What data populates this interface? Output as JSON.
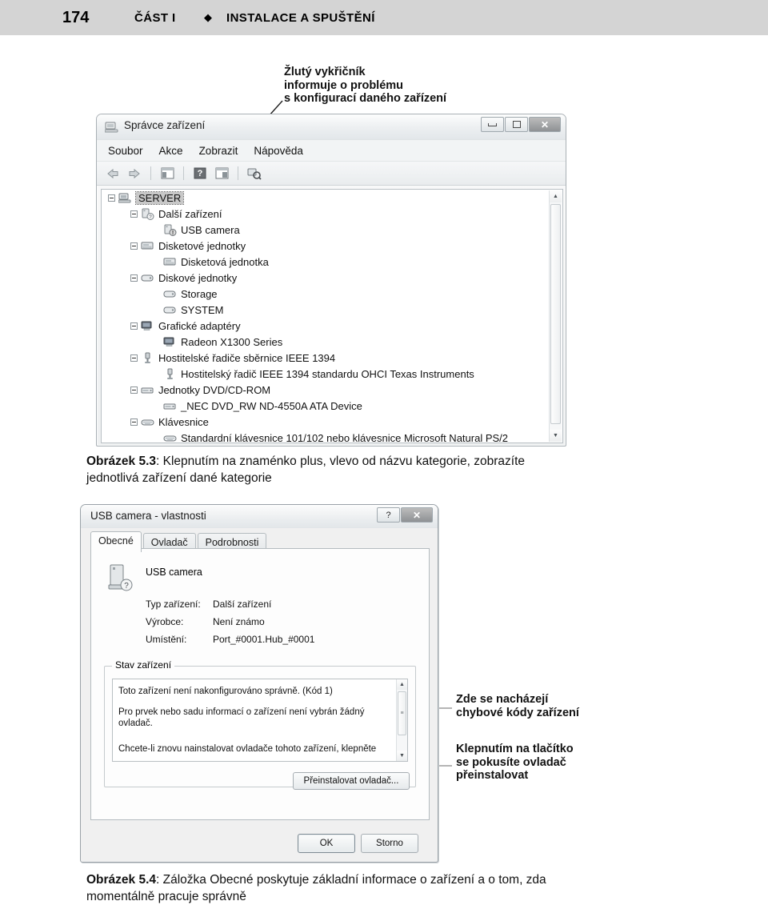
{
  "runhead": {
    "page_number": "174",
    "part_label": "ČÁST I",
    "separator": "◆",
    "chapter_label": "INSTALACE A SPUŠTĚNÍ"
  },
  "callouts": {
    "top": "Žlutý vykřičník\ninformuje o problému\ns konfigurací daného zařízení",
    "error_codes": "Zde se nacházejí\nchybové kódy zařízení",
    "reinstall": "Klepnutím na tlačítko\nse pokusíte ovladač\npřeinstalovat"
  },
  "device_manager": {
    "title": "Správce zařízení",
    "title_icon": "device-manager-icon",
    "window_buttons": [
      {
        "name": "minimize-button",
        "glyph": "–"
      },
      {
        "name": "maximize-button",
        "glyph": "□"
      },
      {
        "name": "close-button",
        "glyph": "✕"
      }
    ],
    "menu": [
      "Soubor",
      "Akce",
      "Zobrazit",
      "Nápověda"
    ],
    "toolbar_icons": [
      "back-arrow-icon",
      "forward-arrow-icon",
      "show-hide-console-tree-icon",
      "help-icon",
      "properties-icon",
      "scan-hardware-changes-icon"
    ],
    "tree": [
      {
        "label": "SERVER",
        "indent": 0,
        "expander": "minus",
        "icon": "computer-icon",
        "selected": true
      },
      {
        "label": "Další zařízení",
        "indent": 1,
        "expander": "minus",
        "icon": "unknown-device-icon",
        "selected": false
      },
      {
        "label": "USB camera",
        "indent": 2,
        "expander": "none",
        "icon": "warning-device-icon",
        "selected": false
      },
      {
        "label": "Disketové jednotky",
        "indent": 1,
        "expander": "minus",
        "icon": "floppy-icon",
        "selected": false
      },
      {
        "label": "Disketová jednotka",
        "indent": 2,
        "expander": "none",
        "icon": "floppy-icon",
        "selected": false
      },
      {
        "label": "Diskové jednotky",
        "indent": 1,
        "expander": "minus",
        "icon": "disk-icon",
        "selected": false
      },
      {
        "label": "Storage",
        "indent": 2,
        "expander": "none",
        "icon": "disk-icon",
        "selected": false
      },
      {
        "label": "SYSTEM",
        "indent": 2,
        "expander": "none",
        "icon": "disk-icon",
        "selected": false
      },
      {
        "label": "Grafické adaptéry",
        "indent": 1,
        "expander": "minus",
        "icon": "display-icon",
        "selected": false
      },
      {
        "label": "Radeon X1300 Series",
        "indent": 2,
        "expander": "none",
        "icon": "display-icon",
        "selected": false
      },
      {
        "label": "Hostitelské řadiče sběrnice IEEE 1394",
        "indent": 1,
        "expander": "minus",
        "icon": "ieee1394-icon",
        "selected": false
      },
      {
        "label": "Hostitelský řadič IEEE 1394 standardu OHCI Texas Instruments",
        "indent": 2,
        "expander": "none",
        "icon": "ieee1394-icon",
        "selected": false
      },
      {
        "label": "Jednotky DVD/CD-ROM",
        "indent": 1,
        "expander": "minus",
        "icon": "dvd-icon",
        "selected": false
      },
      {
        "label": "_NEC DVD_RW ND-4550A ATA Device",
        "indent": 2,
        "expander": "none",
        "icon": "dvd-icon",
        "selected": false
      },
      {
        "label": "Klávesnice",
        "indent": 1,
        "expander": "minus",
        "icon": "keyboard-icon",
        "selected": false
      },
      {
        "label": "Standardní klávesnice 101/102 nebo klávesnice Microsoft Natural PS/2",
        "indent": 2,
        "expander": "none",
        "icon": "keyboard-icon",
        "selected": false
      }
    ]
  },
  "caption_53": {
    "figure": "Obrázek 5.3",
    "text": ": Klepnutím na znaménko plus, vlevo od názvu kategorie, zobrazíte jednotlivá zařízení dané kategorie"
  },
  "properties_dialog": {
    "title": "USB camera - vlastnosti",
    "window_buttons": [
      {
        "name": "help-button",
        "glyph": "?"
      },
      {
        "name": "close-button",
        "glyph": "✕"
      }
    ],
    "tabs": [
      {
        "label": "Obecné",
        "active": true
      },
      {
        "label": "Ovladač",
        "active": false
      },
      {
        "label": "Podrobnosti",
        "active": false
      }
    ],
    "device_icon": "unknown-device-icon",
    "device_name": "USB camera",
    "properties": [
      {
        "key": "Typ zařízení:",
        "value": "Další zařízení"
      },
      {
        "key": "Výrobce:",
        "value": "Není známo"
      },
      {
        "key": "Umístění:",
        "value": "Port_#0001.Hub_#0001"
      }
    ],
    "status_group_label": "Stav zařízení",
    "status_lines": [
      "Toto zařízení není nakonfigurováno správně. (Kód 1)",
      "Pro prvek nebo sadu informací o zařízení není vybrán žádný ovladač.",
      "Chcete-li znovu nainstalovat ovladače tohoto zařízení, klepněte"
    ],
    "reinstall_button": "Přeinstalovat ovladač...",
    "ok_button": "OK",
    "cancel_button": "Storno"
  },
  "caption_54": {
    "figure": "Obrázek 5.4",
    "text": ": Záložka Obecné poskytuje základní informace o zařízení a o tom, zda momentálně pracuje správně"
  },
  "colors": {
    "runhead_bg": "#d4d4d4",
    "window_bg": "#f0f0f0",
    "panel_bg": "#fdfdfd",
    "text": "#111111",
    "selection_bg": "#c8c8c8"
  }
}
